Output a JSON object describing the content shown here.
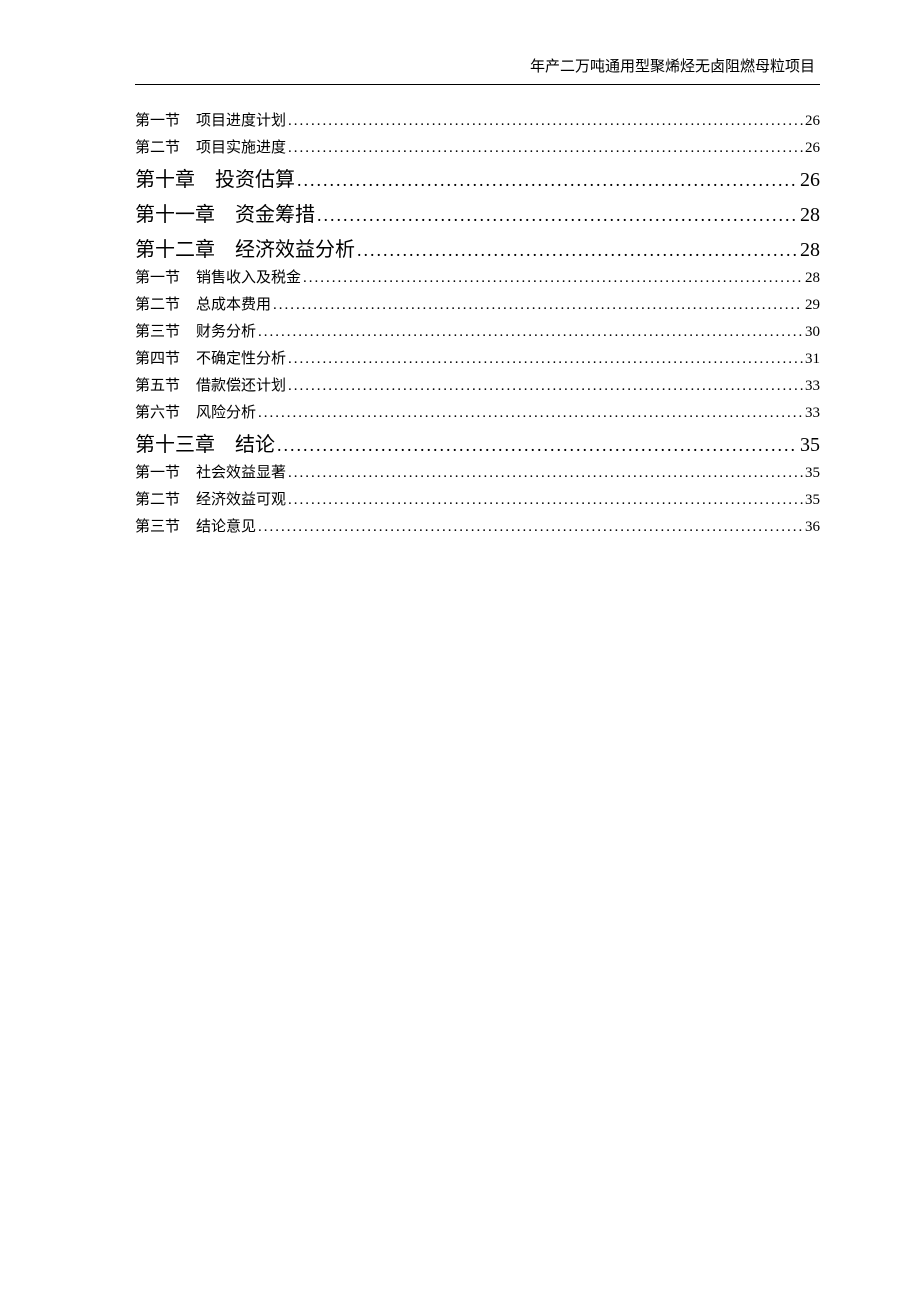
{
  "header_text": "年产二万吨通用型聚烯烃无卤阻燃母粒项目",
  "toc": [
    {
      "level": "section",
      "label": "第一节",
      "title": "项目进度计划",
      "page": "26"
    },
    {
      "level": "section",
      "label": "第二节",
      "title": "项目实施进度",
      "page": "26"
    },
    {
      "level": "chapter",
      "label": "第十章",
      "title": "投资估算",
      "page": "26"
    },
    {
      "level": "chapter",
      "label": "第十一章",
      "title": "资金筹措",
      "page": "28"
    },
    {
      "level": "chapter",
      "label": "第十二章",
      "title": "经济效益分析",
      "page": "28"
    },
    {
      "level": "section",
      "label": "第一节",
      "title": "销售收入及税金",
      "page": "28"
    },
    {
      "level": "section",
      "label": "第二节",
      "title": "总成本费用",
      "page": "29"
    },
    {
      "level": "section",
      "label": "第三节",
      "title": "财务分析",
      "page": "30"
    },
    {
      "level": "section",
      "label": "第四节",
      "title": "不确定性分析",
      "page": "31"
    },
    {
      "level": "section",
      "label": "第五节",
      "title": "借款偿还计划",
      "page": "33"
    },
    {
      "level": "section",
      "label": "第六节",
      "title": "风险分析",
      "page": "33"
    },
    {
      "level": "chapter",
      "label": "第十三章",
      "title": "结论",
      "page": "35"
    },
    {
      "level": "section",
      "label": "第一节",
      "title": "社会效益显著",
      "page": "35"
    },
    {
      "level": "section",
      "label": "第二节",
      "title": "经济效益可观",
      "page": "35"
    },
    {
      "level": "section",
      "label": "第三节",
      "title": "结论意见",
      "page": "36"
    }
  ]
}
